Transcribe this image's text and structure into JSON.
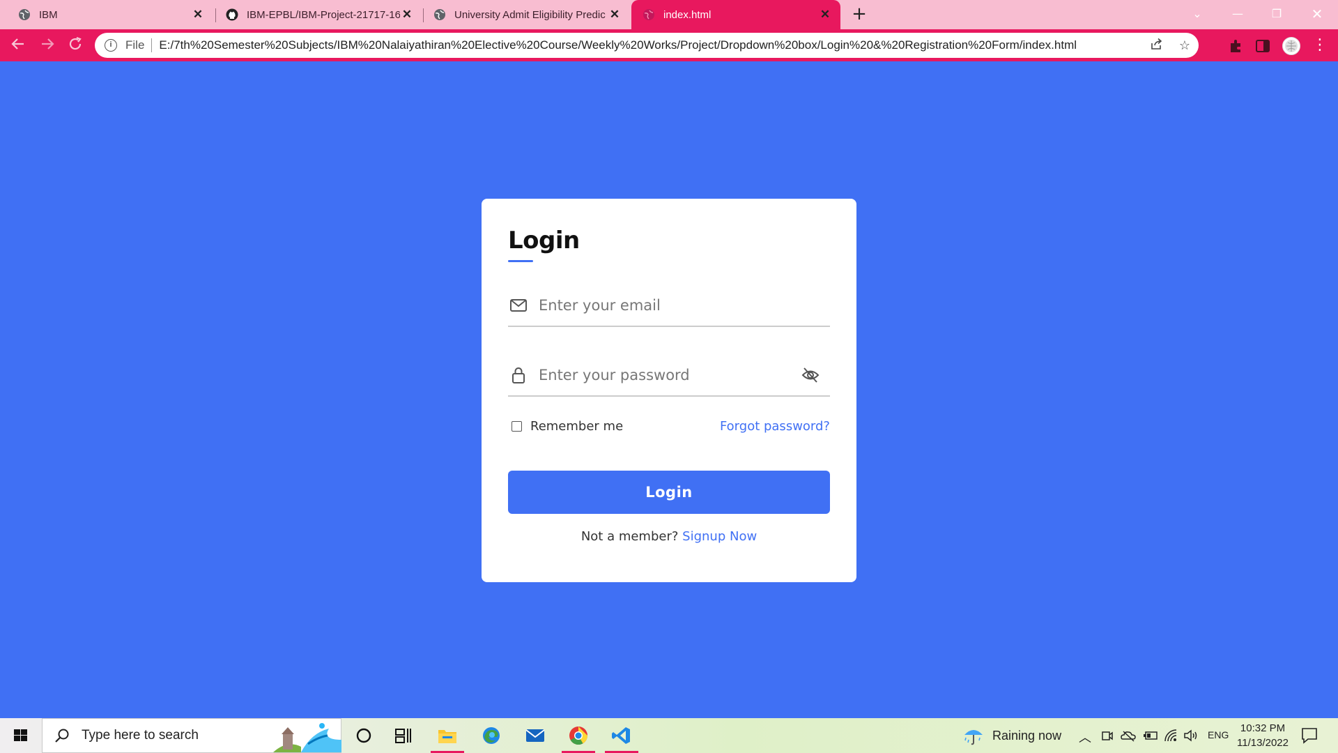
{
  "browser": {
    "tabs": [
      {
        "title": "IBM",
        "icon": "globe-icon"
      },
      {
        "title": "IBM-EPBL/IBM-Project-21717-16",
        "icon": "github-icon"
      },
      {
        "title": "University Admit Eligibility Predic",
        "icon": "globe-icon"
      },
      {
        "title": "index.html",
        "icon": "globe-icon",
        "active": true
      }
    ],
    "omnibox": {
      "scheme_label": "File",
      "url": "E:/7th%20Semester%20Subjects/IBM%20Nalaiyathiran%20Elective%20Course/Weekly%20Works/Project/Dropdown%20box/Login%20&%20Registration%20Form/index.html"
    },
    "accent_color": "#e8185e",
    "tabstrip_color": "#f8bdd1"
  },
  "login_form": {
    "title": "Login",
    "email_placeholder": "Enter your email",
    "password_placeholder": "Enter your password",
    "remember_label": "Remember me",
    "forgot_label": "Forgot password?",
    "submit_label": "Login",
    "signup_prompt": "Not a member?",
    "signup_link": "Signup Now",
    "accent_color": "#4070f4"
  },
  "taskbar": {
    "search_placeholder": "Type here to search",
    "weather": "Raining now",
    "language": "ENG",
    "time": "10:32 PM",
    "date": "11/13/2022"
  }
}
